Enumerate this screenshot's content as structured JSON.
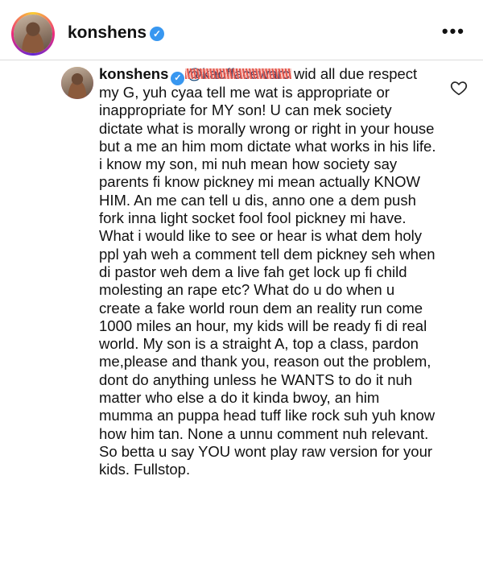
{
  "header": {
    "username": "konshens",
    "verified_glyph": "✓",
    "more_glyph": "•••"
  },
  "comment": {
    "username": "konshens",
    "mention": "@kaoffacewarc",
    "body": "wid all due respect my G, yuh cyaa tell me wat is appropriate or inappropriate for MY son! U can mek society dictate what is morally wrong or right in your house but a me an him mom dictate what works in his life. i know my son, mi nuh mean how society say parents fi know pickney mi mean actually KNOW HIM. An me can tell u dis, anno one a dem push fork inna light socket fool fool pickney mi have.  What i would like to see or hear is what dem holy ppl yah weh a comment tell dem pickney seh when di pastor weh dem a live fah get lock up fi child molesting an rape etc? What do u do when u create a fake world roun dem an reality run come 1000 miles an hour, my kids will be ready fi di real world. My son is a straight A, top a class, pardon me,please and thank you, reason out the problem, dont do anything unless he WANTS to do it nuh matter who else a do it kinda bwoy, an him mumma an puppa head tuff like rock suh yuh know how him tan. None a unnu comment nuh relevant.  So betta u say YOU wont play raw version for your kids. Fullstop."
  },
  "icons": {
    "verified": "verified-badge-icon",
    "more": "more-options-icon",
    "like": "heart-icon"
  },
  "colors": {
    "verified_blue": "#3897f0",
    "mention_blue": "#00376b",
    "scribble_red": "#e4574c"
  }
}
